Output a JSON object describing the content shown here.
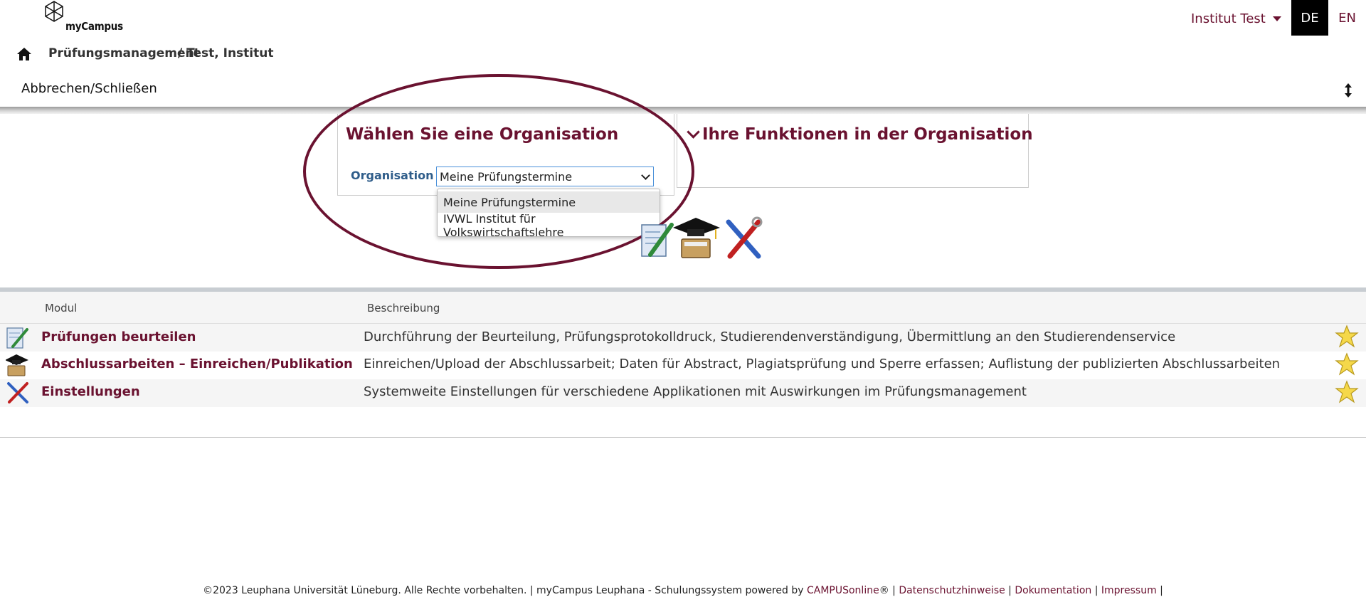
{
  "header": {
    "logo_text": "myCampus",
    "user_label": "Institut Test",
    "lang_de": "DE",
    "lang_en": "EN"
  },
  "breadcrumb": {
    "module": "Prüfungsmanagement",
    "context": "/ Test, Institut"
  },
  "toolbar": {
    "cancel_label": "Abbrechen/Schließen"
  },
  "panels": {
    "select_title": "Wählen Sie eine Organisation",
    "functions_title": "Ihre Funktionen in der Organisation",
    "org_label": "Organisation",
    "org_selected": "Meine Prüfungstermine",
    "org_options": [
      "Meine Prüfungstermine",
      "IVWL Institut für Volkswirtschaftslehre"
    ]
  },
  "table": {
    "headers": [
      "Modul",
      "Beschreibung"
    ],
    "rows": [
      {
        "title": "Prüfungen beurteilen",
        "desc": "Durchführung der Beurteilung, Prüfungsprotokolldruck, Studierendenverständigung, Übermittlung an den Studierendenservice",
        "icon": "exam-edit-icon"
      },
      {
        "title": "Abschlussarbeiten – Einreichen/Publikation",
        "desc": "Einreichen/Upload der Abschlussarbeit; Daten für Abstract, Plagiatsprüfung und Sperre erfassen; Auflistung der publizierten Abschlussarbeiten",
        "icon": "graduation-cap-icon"
      },
      {
        "title": "Einstellungen",
        "desc": "Systemweite Einstellungen für verschiedene Applikationen mit Auswirkungen im Prüfungsmanagement",
        "icon": "tools-icon"
      }
    ]
  },
  "footer": {
    "copyright": "©2023 Leuphana Universität Lüneburg. Alle Rechte vorbehalten. | myCampus Leuphana - Schulungssystem powered by ",
    "campus_link": "CAMPUSonline",
    "reg": "® | ",
    "privacy": "Datenschutzhinweise",
    "sep1": " | ",
    "docs": "Dokumentation",
    "sep2": " | ",
    "imprint": "Impressum",
    "sep3": " |"
  },
  "colors": {
    "accent": "#6a1230",
    "label_blue": "#2f5d8a"
  }
}
